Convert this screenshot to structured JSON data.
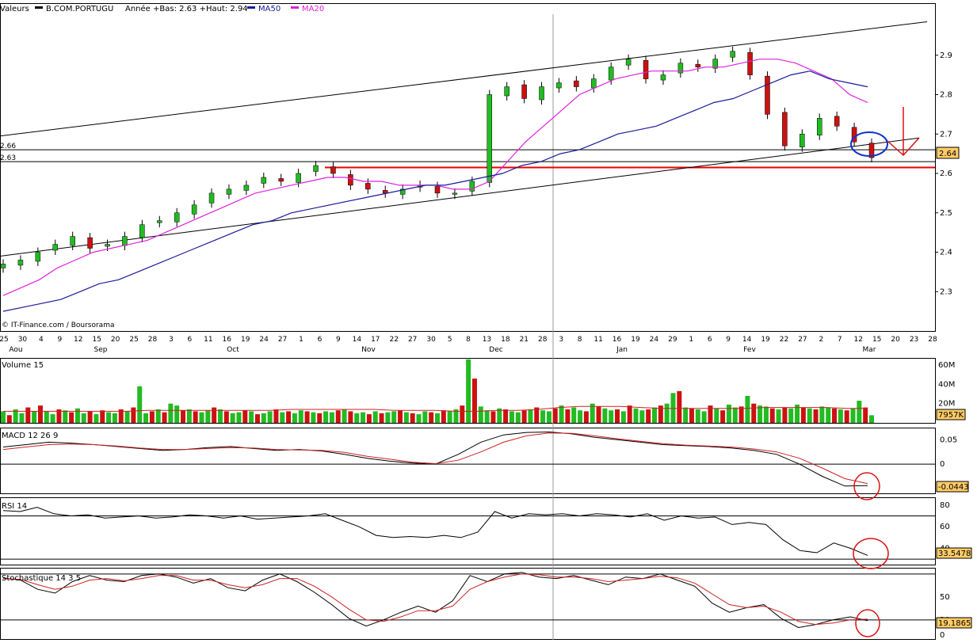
{
  "header": {
    "valeurs": "Valeurs",
    "ticker": "B.COM.PORTUGU",
    "annee": "Année +Bas: 2.63 +Haut: 2.94",
    "ma50": "MA50",
    "ma20": "MA20"
  },
  "colors": {
    "up": "#22bb22",
    "down": "#cc1111",
    "ma50": "#1a1a99",
    "ma20": "#dd22dd",
    "signal": "#cc2222",
    "support": "#ee0000",
    "last_price_bg": "#ffcc66"
  },
  "credit": "© IT-Finance.com / Boursorama",
  "x_axis": {
    "days": [
      "25",
      "30",
      "4",
      "9",
      "12",
      "15",
      "20",
      "25",
      "28",
      "3",
      "6",
      "11",
      "16",
      "19",
      "24",
      "27",
      "1",
      "6",
      "9",
      "14",
      "17",
      "22",
      "27",
      "30",
      "5",
      "8",
      "13",
      "18",
      "21",
      "28",
      "3",
      "8",
      "11",
      "16",
      "19",
      "24",
      "29",
      "1",
      "6",
      "9",
      "14",
      "19",
      "22",
      "27",
      "2",
      "7",
      "12",
      "15",
      "20",
      "23",
      "28"
    ],
    "months": [
      "Aou",
      "Sep",
      "Oct",
      "Nov",
      "Dec",
      "Jan",
      "Fev",
      "Mar"
    ]
  },
  "chart_data": [
    {
      "type": "candlestick",
      "title": "B.COM.PORTUGU",
      "ylim": [
        2.2,
        3.0
      ],
      "y_ticks": [
        "2.9",
        "2.8",
        "2.7",
        "2.6",
        "2.5",
        "2.4",
        "2.3"
      ],
      "last_price": "2.64",
      "level_labels": [
        "2.66",
        "2.63"
      ],
      "levels": [
        2.66,
        2.63
      ],
      "support_level": 2.615,
      "series": [
        {
          "name": "B.COM.PORTUGU",
          "close": [
            2.37,
            2.38,
            2.4,
            2.42,
            2.44,
            2.41,
            2.42,
            2.44,
            2.47,
            2.48,
            2.5,
            2.52,
            2.55,
            2.56,
            2.57,
            2.59,
            2.58,
            2.6,
            2.62,
            2.6,
            2.57,
            2.56,
            2.55,
            2.56,
            2.57,
            2.55,
            2.55,
            2.58,
            2.8,
            2.82,
            2.79,
            2.82,
            2.83,
            2.82,
            2.84,
            2.87,
            2.89,
            2.84,
            2.85,
            2.88,
            2.87,
            2.89,
            2.91,
            2.85,
            2.75,
            2.67,
            2.7,
            2.74,
            2.72,
            2.68,
            2.64
          ]
        },
        {
          "name": "MA20",
          "values": [
            2.29,
            2.31,
            2.33,
            2.36,
            2.38,
            2.4,
            2.41,
            2.42,
            2.43,
            2.45,
            2.47,
            2.49,
            2.51,
            2.53,
            2.55,
            2.56,
            2.57,
            2.58,
            2.59,
            2.59,
            2.58,
            2.58,
            2.57,
            2.57,
            2.57,
            2.56,
            2.56,
            2.58,
            2.63,
            2.68,
            2.72,
            2.76,
            2.8,
            2.82,
            2.84,
            2.85,
            2.86,
            2.86,
            2.86,
            2.87,
            2.87,
            2.88,
            2.89,
            2.89,
            2.88,
            2.86,
            2.84,
            2.8,
            2.78
          ]
        },
        {
          "name": "MA50",
          "values": [
            2.25,
            2.26,
            2.27,
            2.28,
            2.3,
            2.32,
            2.33,
            2.35,
            2.37,
            2.39,
            2.41,
            2.43,
            2.45,
            2.47,
            2.48,
            2.5,
            2.51,
            2.52,
            2.53,
            2.54,
            2.55,
            2.56,
            2.57,
            2.57,
            2.58,
            2.59,
            2.6,
            2.62,
            2.63,
            2.65,
            2.66,
            2.68,
            2.7,
            2.71,
            2.72,
            2.74,
            2.76,
            2.78,
            2.79,
            2.81,
            2.83,
            2.85,
            2.86,
            2.84,
            2.83,
            2.82
          ]
        }
      ]
    },
    {
      "type": "bar",
      "title": "Volume 15",
      "y_ticks": [
        "60M",
        "40M",
        "20M"
      ],
      "ylim": [
        0,
        65
      ],
      "last_value": "7957K",
      "values": [
        12,
        8,
        14,
        10,
        16,
        12,
        18,
        12,
        9,
        14,
        13,
        11,
        15,
        10,
        12,
        9,
        13,
        11,
        10,
        14,
        12,
        16,
        38,
        10,
        12,
        14,
        11,
        20,
        18,
        13,
        14,
        12,
        11,
        13,
        16,
        14,
        12,
        10,
        11,
        13,
        12,
        9,
        10,
        12,
        14,
        11,
        12,
        10,
        13,
        12,
        11,
        10,
        12,
        11,
        13,
        14,
        12,
        10,
        11,
        9,
        12,
        10,
        11,
        12,
        13,
        11,
        10,
        9,
        12,
        11,
        10,
        13,
        12,
        14,
        18,
        66,
        46,
        17,
        13,
        12,
        15,
        14,
        12,
        11,
        13,
        14,
        16,
        13,
        12,
        15,
        18,
        14,
        16,
        13,
        12,
        20,
        17,
        15,
        13,
        14,
        12,
        18,
        15,
        13,
        14,
        16,
        18,
        20,
        31,
        33,
        16,
        15,
        14,
        12,
        18,
        15,
        13,
        19,
        16,
        17,
        28,
        20,
        18,
        17,
        15,
        14,
        16,
        15,
        19,
        16,
        15,
        14,
        17,
        16,
        15,
        14,
        13,
        15,
        23,
        16,
        7.9
      ],
      "ma_values": [
        12,
        12,
        12,
        12,
        12,
        12,
        12,
        13,
        13,
        13,
        13,
        13,
        13,
        13,
        14,
        14,
        14,
        14,
        14,
        13,
        13,
        13,
        12,
        12,
        13,
        13,
        14,
        16,
        17,
        17,
        17,
        16,
        15,
        15,
        15,
        15,
        15,
        16,
        16,
        16,
        16,
        15,
        15
      ]
    },
    {
      "type": "line",
      "title": "MACD 12 26 9",
      "ylim": [
        -0.06,
        0.07
      ],
      "y_ticks": [
        "0.05",
        "0"
      ],
      "last_value": "-0.0443",
      "series": [
        {
          "name": "MACD",
          "values": [
            0.035,
            0.04,
            0.045,
            0.043,
            0.04,
            0.036,
            0.032,
            0.028,
            0.03,
            0.034,
            0.036,
            0.032,
            0.028,
            0.03,
            0.027,
            0.02,
            0.012,
            0.006,
            0.002,
            0,
            0.02,
            0.045,
            0.06,
            0.065,
            0.066,
            0.062,
            0.055,
            0.05,
            0.045,
            0.04,
            0.038,
            0.036,
            0.033,
            0.028,
            0.02,
            0.0,
            -0.025,
            -0.045,
            -0.044
          ]
        },
        {
          "name": "Signal",
          "values": [
            0.03,
            0.035,
            0.04,
            0.041,
            0.04,
            0.037,
            0.033,
            0.03,
            0.03,
            0.032,
            0.034,
            0.033,
            0.03,
            0.029,
            0.028,
            0.024,
            0.016,
            0.01,
            0.004,
            0.001,
            0.008,
            0.025,
            0.045,
            0.058,
            0.064,
            0.063,
            0.058,
            0.052,
            0.047,
            0.042,
            0.039,
            0.037,
            0.035,
            0.031,
            0.025,
            0.012,
            -0.008,
            -0.03,
            -0.04
          ]
        }
      ]
    },
    {
      "type": "line",
      "title": "RSI 14",
      "ylim": [
        25,
        85
      ],
      "y_ticks": [
        "80",
        "60",
        "40"
      ],
      "last_value": "33.5478",
      "levels": [
        70,
        30
      ],
      "series": [
        {
          "name": "RSI 14",
          "values": [
            75,
            74,
            78,
            72,
            70,
            71,
            68,
            69,
            70,
            68,
            69,
            71,
            70,
            68,
            70,
            67,
            68,
            69,
            70,
            72,
            66,
            60,
            52,
            50,
            51,
            50,
            52,
            50,
            55,
            74,
            68,
            72,
            71,
            72,
            70,
            72,
            71,
            69,
            72,
            66,
            70,
            68,
            69,
            62,
            64,
            62,
            48,
            38,
            36,
            45,
            40,
            33.5
          ]
        }
      ]
    },
    {
      "type": "line",
      "title": "Stochastique 14 3 5",
      "ylim": [
        -5,
        85
      ],
      "y_ticks": [
        "50",
        "20",
        "0"
      ],
      "last_value": "19.1865",
      "levels": [
        80,
        20
      ],
      "series": [
        {
          "name": "%K",
          "values": [
            75,
            72,
            60,
            55,
            70,
            78,
            72,
            70,
            78,
            80,
            76,
            68,
            74,
            62,
            58,
            72,
            80,
            70,
            56,
            40,
            22,
            12,
            20,
            30,
            38,
            30,
            45,
            78,
            70,
            80,
            82,
            76,
            74,
            78,
            72,
            66,
            76,
            74,
            80,
            72,
            64,
            42,
            30,
            36,
            40,
            22,
            10,
            14,
            20,
            24,
            19
          ]
        },
        {
          "name": "%D",
          "values": [
            74,
            73,
            66,
            60,
            64,
            72,
            74,
            71,
            74,
            78,
            78,
            72,
            72,
            66,
            62,
            66,
            74,
            74,
            64,
            50,
            34,
            20,
            18,
            24,
            32,
            32,
            38,
            60,
            70,
            76,
            80,
            79,
            76,
            76,
            74,
            70,
            72,
            74,
            77,
            75,
            68,
            54,
            40,
            36,
            38,
            30,
            18,
            14,
            16,
            20,
            21
          ]
        }
      ]
    }
  ],
  "annotations": {
    "circles": 4,
    "arrow": "down"
  }
}
